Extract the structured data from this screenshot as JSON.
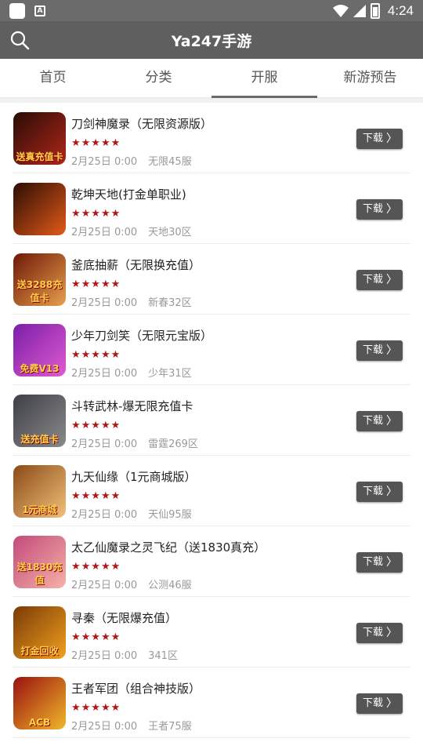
{
  "status_bar": {
    "time": "4:24",
    "notification_badge": "A"
  },
  "app_bar": {
    "title": "Ya247手游"
  },
  "tabs": [
    {
      "label": "首页"
    },
    {
      "label": "分类"
    },
    {
      "label": "开服",
      "active": true
    },
    {
      "label": "新游预告"
    }
  ],
  "download_label": "下载",
  "stars": "★★★★★",
  "games": [
    {
      "name": "刀剑神魔录（无限资源版）",
      "date": "2月25日 0:00",
      "server": "无限45服",
      "icon_caption": "送真充值卡",
      "icon_colors": [
        "#2a0c05",
        "#b0261a"
      ]
    },
    {
      "name": "乾坤天地(打金单职业)",
      "date": "2月25日 0:00",
      "server": "天地30区",
      "icon_caption": "",
      "icon_colors": [
        "#2b0d03",
        "#e3591a"
      ]
    },
    {
      "name": "釜底抽薪（无限换充值）",
      "date": "2月25日 0:00",
      "server": "新春32区",
      "icon_caption": "送3288充值卡",
      "icon_colors": [
        "#6e1707",
        "#e7a04d"
      ]
    },
    {
      "name": "少年刀剑笑（无限元宝版）",
      "date": "2月25日 0:00",
      "server": "少年31区",
      "icon_caption": "免费V13",
      "icon_colors": [
        "#7a1ea8",
        "#e05bd0"
      ]
    },
    {
      "name": "斗转武林-爆无限充值卡",
      "date": "2月25日 0:00",
      "server": "雷霆269区",
      "icon_caption": "送充值卡",
      "icon_colors": [
        "#3e3f47",
        "#8a8a8a"
      ]
    },
    {
      "name": "九天仙缘（1元商城版）",
      "date": "2月25日 0:00",
      "server": "天仙95服",
      "icon_caption": "1元商城",
      "icon_colors": [
        "#8a4b16",
        "#f2c07a"
      ]
    },
    {
      "name": "太乙仙魔录之灵飞纪（送1830真充）",
      "date": "2月25日 0:00",
      "server": "公测46服",
      "icon_caption": "送1830充值",
      "icon_colors": [
        "#c24a7a",
        "#f6b1a8"
      ]
    },
    {
      "name": "寻秦（无限爆充值）",
      "date": "2月25日 0:00",
      "server": "341区",
      "icon_caption": "打金回收",
      "icon_colors": [
        "#7a3a05",
        "#f0a020"
      ]
    },
    {
      "name": "王者军团（组合神技版）",
      "date": "2月25日 0:00",
      "server": "王者75服",
      "icon_caption": "ACB",
      "icon_colors": [
        "#9a1010",
        "#f0b82a"
      ]
    }
  ]
}
